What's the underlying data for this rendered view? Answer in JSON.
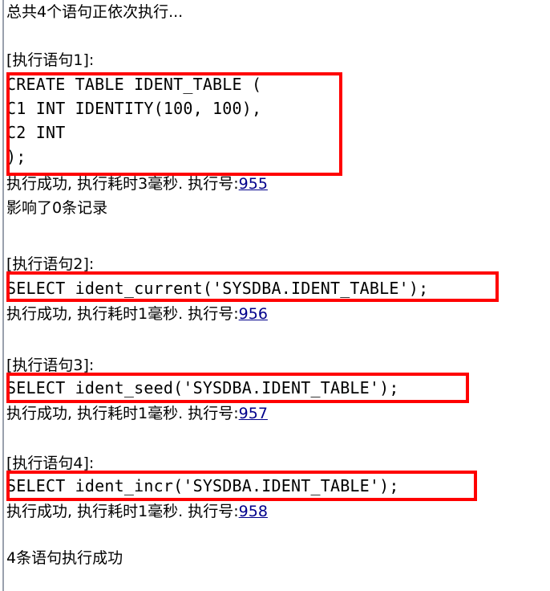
{
  "pane": {
    "name": "sql-execution-log",
    "background_color": "#ffffff",
    "gutter_color": "#9aa0ad",
    "annotation_color": "#ff0000",
    "link_color": "#00008b"
  },
  "header": {
    "summary": "总共4个语句正依次执行..."
  },
  "footer": {
    "summary": "4条语句执行成功"
  },
  "statements": [
    {
      "label": "[执行语句1]:",
      "sql_lines": [
        "CREATE TABLE IDENT_TABLE (",
        "C1 INT IDENTITY(100, 100),",
        "C2 INT",
        ");"
      ],
      "result_prefix": "执行成功, 执行耗时3毫秒. 执行号:",
      "exec_id": "955",
      "affected": "影响了0条记录"
    },
    {
      "label": "[执行语句2]:",
      "sql_lines": [
        "SELECT ident_current('SYSDBA.IDENT_TABLE');"
      ],
      "result_prefix": "执行成功, 执行耗时1毫秒. 执行号:",
      "exec_id": "956",
      "affected": ""
    },
    {
      "label": "[执行语句3]:",
      "sql_lines": [
        "SELECT ident_seed('SYSDBA.IDENT_TABLE');"
      ],
      "result_prefix": "执行成功, 执行耗时1毫秒. 执行号:",
      "exec_id": "957",
      "affected": ""
    },
    {
      "label": "[执行语句4]:",
      "sql_lines": [
        "SELECT ident_incr('SYSDBA.IDENT_TABLE');"
      ],
      "result_prefix": "执行成功, 执行耗时1毫秒. 执行号:",
      "exec_id": "958",
      "affected": ""
    }
  ]
}
